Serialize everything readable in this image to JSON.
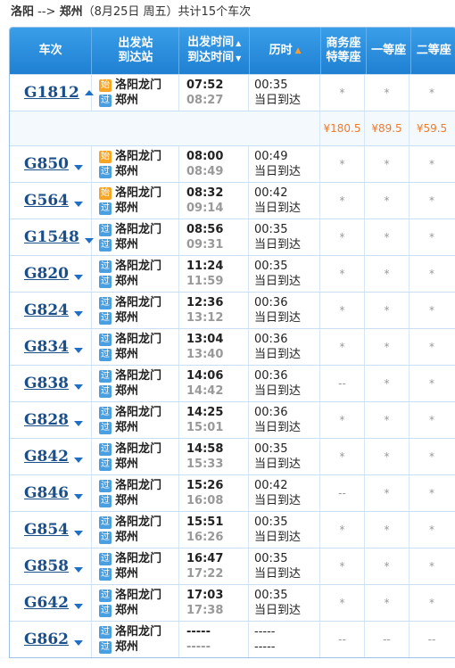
{
  "title": {
    "from": "洛阳",
    "arrow": "-->",
    "to": "郑州",
    "date": "（8月25日  周五）",
    "count": "共计15个车次"
  },
  "headers": {
    "train": "车次",
    "station_line1": "出发站",
    "station_line2": "到达站",
    "time_line1": "出发时间",
    "time_line2": "到达时间",
    "duration": "历时",
    "business_line1": "商务座",
    "business_line2": "特等座",
    "first": "一等座",
    "second": "二等座"
  },
  "colors": {
    "header_bg": "#2a8fe0",
    "start_badge": "#f6a623",
    "pass_badge": "#4a9fe0",
    "price": "#f07a2a"
  },
  "badges": {
    "start": "始",
    "pass": "过"
  },
  "prices": {
    "business": "¥180.5",
    "first": "¥89.5",
    "second": "¥59.5"
  },
  "trains": [
    {
      "no": "G1812",
      "expanded": true,
      "from_badge": "始",
      "from": "洛阳龙门",
      "to_badge": "过",
      "to": "郑州",
      "dep": "07:52",
      "arr": "08:27",
      "dur": "00:35",
      "day": "当日到达",
      "business": "*",
      "first": "*",
      "second": "*"
    },
    {
      "no": "G850",
      "from_badge": "始",
      "from": "洛阳龙门",
      "to_badge": "过",
      "to": "郑州",
      "dep": "08:00",
      "arr": "08:49",
      "dur": "00:49",
      "day": "当日到达",
      "business": "*",
      "first": "*",
      "second": "*"
    },
    {
      "no": "G564",
      "from_badge": "始",
      "from": "洛阳龙门",
      "to_badge": "过",
      "to": "郑州",
      "dep": "08:32",
      "arr": "09:14",
      "dur": "00:42",
      "day": "当日到达",
      "business": "*",
      "first": "*",
      "second": "*"
    },
    {
      "no": "G1548",
      "from_badge": "过",
      "from": "洛阳龙门",
      "to_badge": "过",
      "to": "郑州",
      "dep": "08:56",
      "arr": "09:31",
      "dur": "00:35",
      "day": "当日到达",
      "business": "*",
      "first": "*",
      "second": "*"
    },
    {
      "no": "G820",
      "from_badge": "过",
      "from": "洛阳龙门",
      "to_badge": "过",
      "to": "郑州",
      "dep": "11:24",
      "arr": "11:59",
      "dur": "00:35",
      "day": "当日到达",
      "business": "*",
      "first": "*",
      "second": "*"
    },
    {
      "no": "G824",
      "from_badge": "过",
      "from": "洛阳龙门",
      "to_badge": "过",
      "to": "郑州",
      "dep": "12:36",
      "arr": "13:12",
      "dur": "00:36",
      "day": "当日到达",
      "business": "*",
      "first": "*",
      "second": "*"
    },
    {
      "no": "G834",
      "from_badge": "过",
      "from": "洛阳龙门",
      "to_badge": "过",
      "to": "郑州",
      "dep": "13:04",
      "arr": "13:40",
      "dur": "00:36",
      "day": "当日到达",
      "business": "*",
      "first": "*",
      "second": "*"
    },
    {
      "no": "G838",
      "from_badge": "过",
      "from": "洛阳龙门",
      "to_badge": "过",
      "to": "郑州",
      "dep": "14:06",
      "arr": "14:42",
      "dur": "00:36",
      "day": "当日到达",
      "business": "--",
      "first": "*",
      "second": "*"
    },
    {
      "no": "G828",
      "from_badge": "过",
      "from": "洛阳龙门",
      "to_badge": "过",
      "to": "郑州",
      "dep": "14:25",
      "arr": "15:01",
      "dur": "00:36",
      "day": "当日到达",
      "business": "*",
      "first": "*",
      "second": "*"
    },
    {
      "no": "G842",
      "from_badge": "过",
      "from": "洛阳龙门",
      "to_badge": "过",
      "to": "郑州",
      "dep": "14:58",
      "arr": "15:33",
      "dur": "00:35",
      "day": "当日到达",
      "business": "*",
      "first": "*",
      "second": "*"
    },
    {
      "no": "G846",
      "from_badge": "过",
      "from": "洛阳龙门",
      "to_badge": "过",
      "to": "郑州",
      "dep": "15:26",
      "arr": "16:08",
      "dur": "00:42",
      "day": "当日到达",
      "business": "--",
      "first": "*",
      "second": "*"
    },
    {
      "no": "G854",
      "from_badge": "过",
      "from": "洛阳龙门",
      "to_badge": "过",
      "to": "郑州",
      "dep": "15:51",
      "arr": "16:26",
      "dur": "00:35",
      "day": "当日到达",
      "business": "*",
      "first": "*",
      "second": "*"
    },
    {
      "no": "G858",
      "from_badge": "过",
      "from": "洛阳龙门",
      "to_badge": "过",
      "to": "郑州",
      "dep": "16:47",
      "arr": "17:22",
      "dur": "00:35",
      "day": "当日到达",
      "business": "*",
      "first": "*",
      "second": "*"
    },
    {
      "no": "G642",
      "from_badge": "过",
      "from": "洛阳龙门",
      "to_badge": "过",
      "to": "郑州",
      "dep": "17:03",
      "arr": "17:38",
      "dur": "00:35",
      "day": "当日到达",
      "business": "*",
      "first": "*",
      "second": "*"
    },
    {
      "no": "G862",
      "from_badge": "过",
      "from": "洛阳龙门",
      "to_badge": "过",
      "to": "郑州",
      "dep": "-----",
      "arr": "-----",
      "dur": "-----",
      "day": "-----",
      "business": "--",
      "first": "--",
      "second": "--"
    }
  ]
}
